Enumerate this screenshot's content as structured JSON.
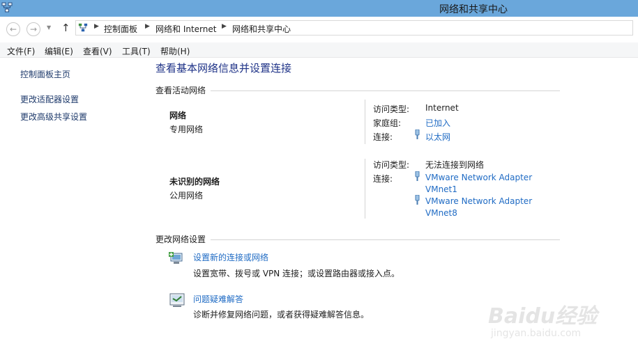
{
  "window": {
    "title": "网络和共享中心"
  },
  "nav": {
    "back_icon": "back-arrow-icon",
    "forward_icon": "forward-arrow-icon",
    "up_icon": "up-arrow-icon",
    "breadcrumb": [
      "控制面板",
      "网络和 Internet",
      "网络和共享中心"
    ]
  },
  "menu": [
    "文件(F)",
    "编辑(E)",
    "查看(V)",
    "工具(T)",
    "帮助(H)"
  ],
  "sidebar": {
    "items": [
      "控制面板主页",
      "更改适配器设置",
      "更改高级共享设置"
    ]
  },
  "main": {
    "title": "查看基本网络信息并设置连接",
    "active_networks_heading": "查看活动网络",
    "networks": [
      {
        "name": "网络",
        "type": "专用网络",
        "access_type_label": "访问类型:",
        "access_type": "Internet",
        "homegroup_label": "家庭组:",
        "homegroup": "已加入",
        "connection_label": "连接:",
        "connection": "以太网"
      },
      {
        "name": "未识别的网络",
        "type": "公用网络",
        "access_type_label": "访问类型:",
        "access_type": "无法连接到网络",
        "connection_label": "连接:",
        "connections": [
          [
            "VMware Network Adapter",
            "VMnet1"
          ],
          [
            "VMware Network Adapter",
            "VMnet8"
          ]
        ]
      }
    ],
    "change_settings_heading": "更改网络设置",
    "tasks": [
      {
        "title": "设置新的连接或网络",
        "desc": "设置宽带、拨号或 VPN 连接；或设置路由器或接入点。",
        "icon": "new-connection-icon"
      },
      {
        "title": "问题疑难解答",
        "desc": "诊断并修复网络问题，或者获得疑难解答信息。",
        "icon": "troubleshoot-icon"
      }
    ]
  },
  "watermark": {
    "logo": "Baidu经验",
    "url": "jingyan.baidu.com"
  },
  "colors": {
    "titlebar": "#6aa7db",
    "link": "#1f6bc4",
    "title": "#1e3287"
  }
}
